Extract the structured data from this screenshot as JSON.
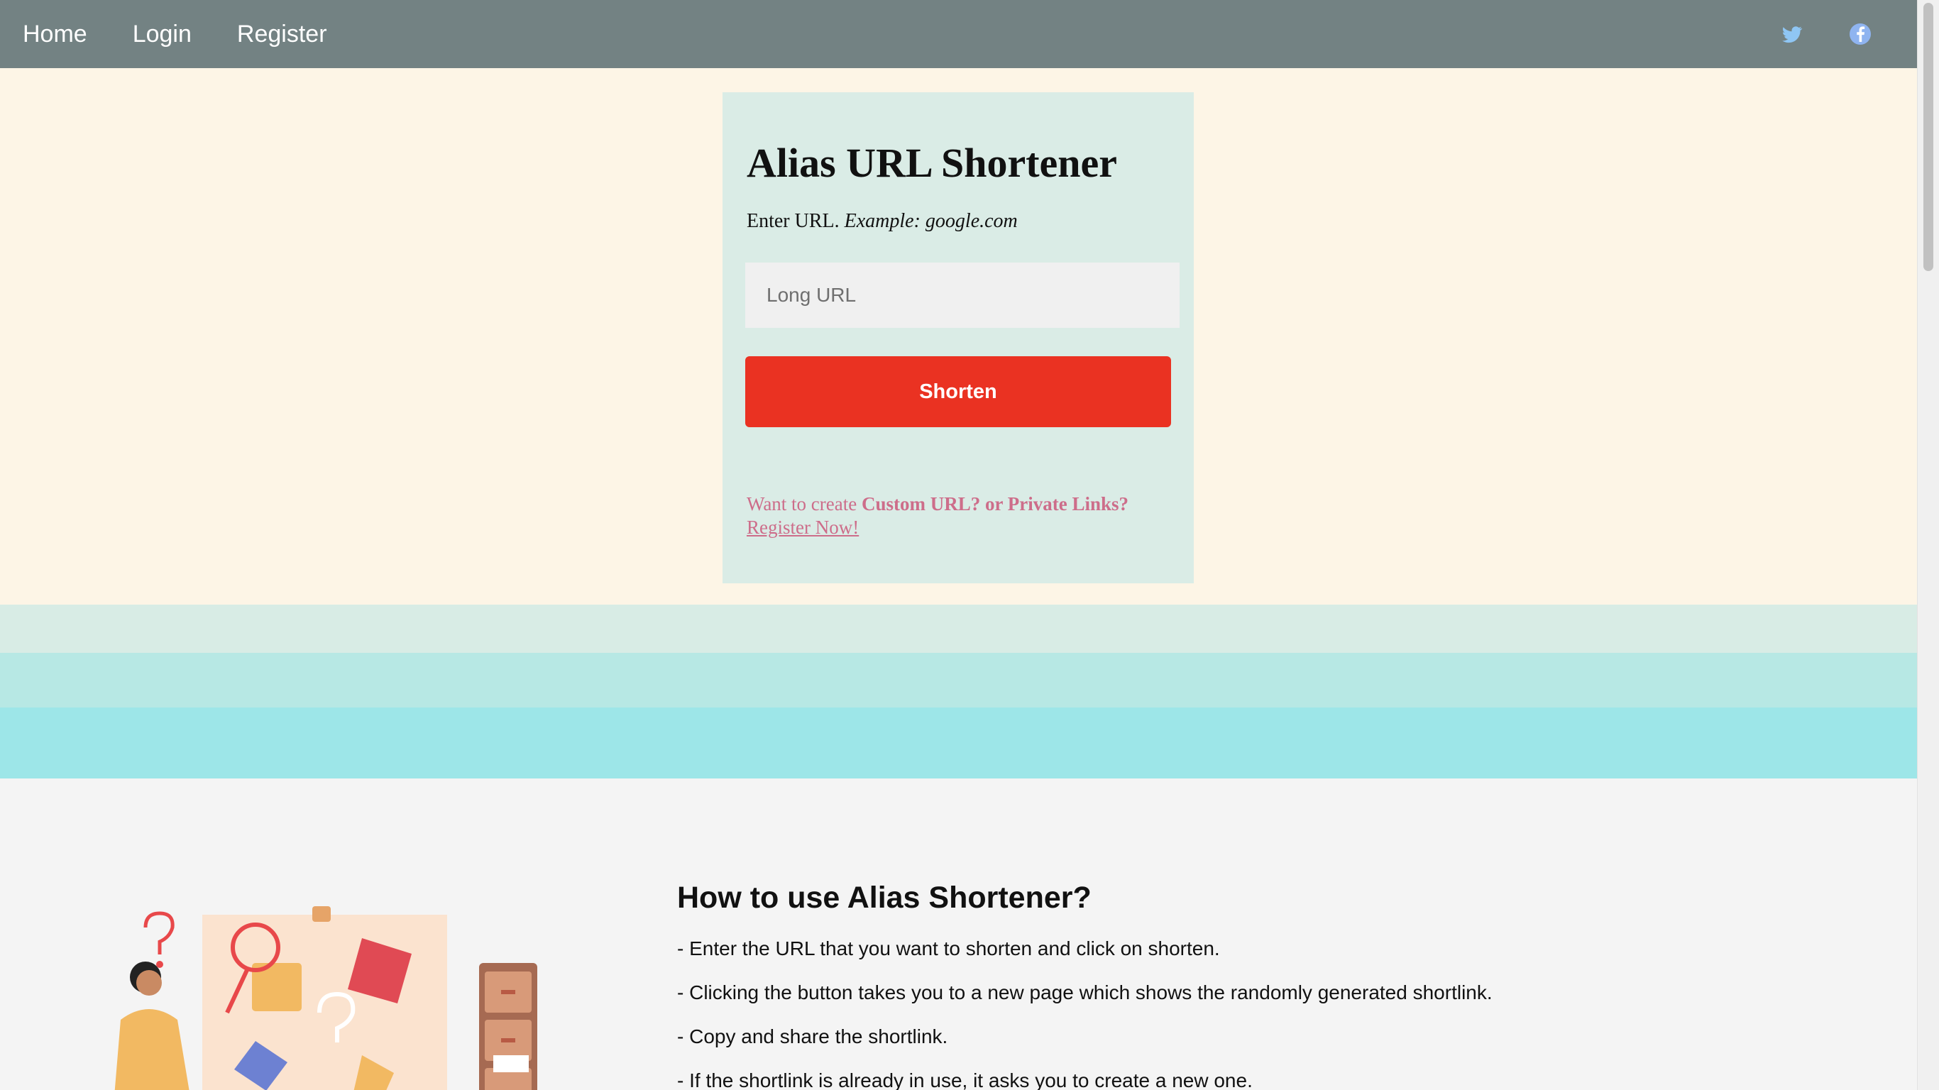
{
  "nav": {
    "items": [
      {
        "label": "Home"
      },
      {
        "label": "Login"
      },
      {
        "label": "Register"
      }
    ],
    "social_icons": [
      "twitter-icon",
      "facebook-icon"
    ]
  },
  "card": {
    "title": "Alias URL Shortener",
    "hint_prefix": "Enter URL.",
    "hint_example": "Example: google.com",
    "input_placeholder": "Long URL",
    "button_label": "Shorten",
    "promo_prefix": "Want to create",
    "promo_bold": "Custom URL? or Private Links?",
    "promo_link": "Register Now!"
  },
  "info": {
    "title": "How to use Alias Shortener?",
    "steps": [
      "- Enter the URL that you want to shorten and click on shorten.",
      "- Clicking the button takes you to a new page which shows the randomly generated shortlink.",
      "- Copy and share the shortlink.",
      "- If the shortlink is already in use, it asks you to create a new one."
    ]
  },
  "colors": {
    "nav_bg": "#738283",
    "hero_bg": "#fdf5e6",
    "card_bg": "#daece6",
    "button_bg": "#ea3222",
    "promo_text": "#cd6d8a"
  }
}
